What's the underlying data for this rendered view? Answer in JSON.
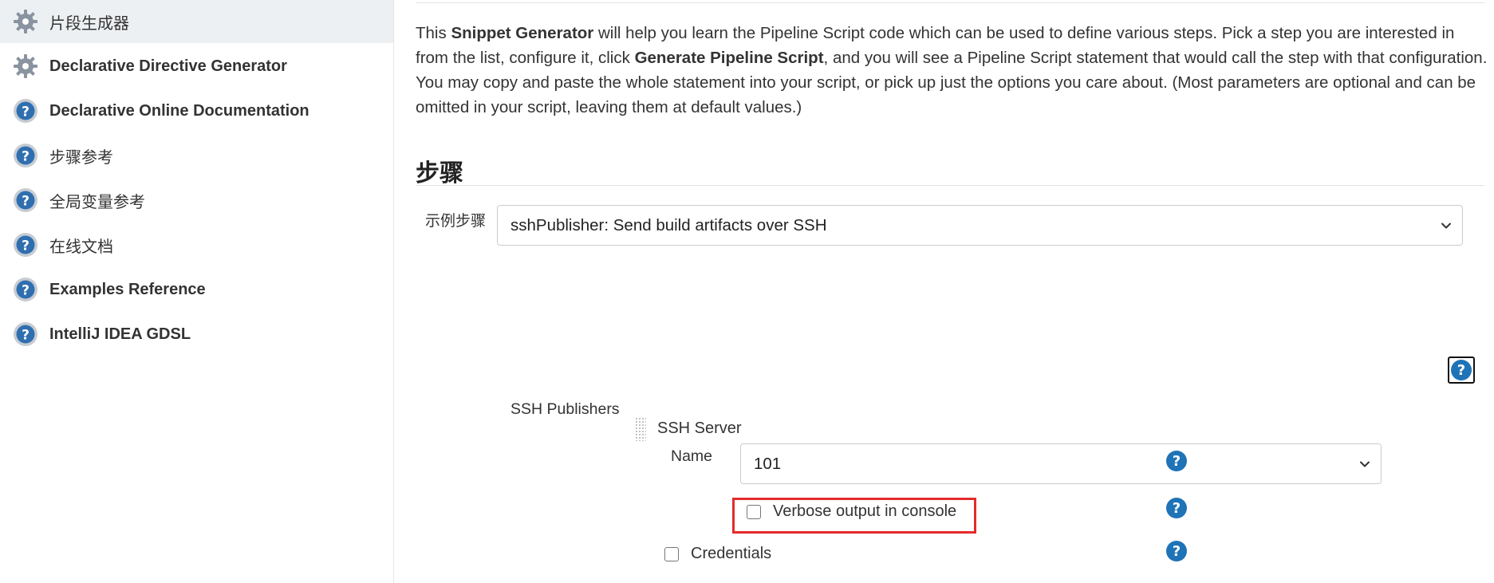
{
  "sidebar": {
    "items": [
      {
        "label": "片段生成器",
        "icon": "gear-icon",
        "active": true
      },
      {
        "label": "Declarative Directive Generator",
        "icon": "gear-icon",
        "active": false
      },
      {
        "label": "Declarative Online Documentation",
        "icon": "help-icon",
        "active": false
      },
      {
        "label": "步骤参考",
        "icon": "help-icon",
        "active": false
      },
      {
        "label": "全局变量参考",
        "icon": "help-icon",
        "active": false
      },
      {
        "label": "在线文档",
        "icon": "help-icon",
        "active": false
      },
      {
        "label": "Examples Reference",
        "icon": "help-icon",
        "active": false
      },
      {
        "label": "IntelliJ IDEA GDSL",
        "icon": "help-icon",
        "active": false
      }
    ]
  },
  "intro": {
    "t1": "This ",
    "b1": "Snippet Generator",
    "t2": " will help you learn the Pipeline Script code which can be used to define various steps. Pick a step you are interested in from the list, configure it, click ",
    "b2": "Generate Pipeline Script",
    "t3": ", and you will see a Pipeline Script statement that would call the step with that configuration. You may copy and paste the whole statement into your script, or pick up just the options you care about. (Most parameters are optional and can be omitted in your script, leaving them at default values.)"
  },
  "steps": {
    "title": "步骤",
    "sample_step_label": "示例步骤",
    "sample_step_value": "sshPublisher: Send build artifacts over SSH"
  },
  "ssh": {
    "publishers_label": "SSH Publishers",
    "server_label": "SSH Server",
    "name_label": "Name",
    "name_value": "101",
    "verbose_label": "Verbose output in console",
    "verbose_checked": false,
    "credentials_label": "Credentials",
    "credentials_checked": false
  },
  "help_glyph": "?",
  "colors": {
    "help_blue": "#1f73b7",
    "highlight_red": "#e42b2b",
    "sidebar_active_bg": "#edf0f2"
  }
}
